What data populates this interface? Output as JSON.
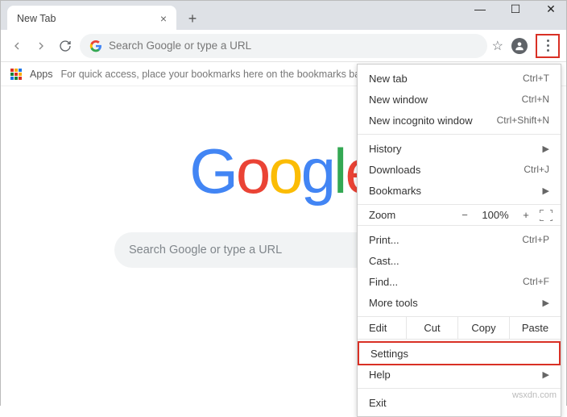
{
  "window": {
    "tab_title": "New Tab"
  },
  "omnibox": {
    "placeholder": "Search Google or type a URL"
  },
  "bookmarks_bar": {
    "apps_label": "Apps",
    "hint": "For quick access, place your bookmarks here on the bookmarks ba"
  },
  "ntp": {
    "logo": [
      "G",
      "o",
      "o",
      "g",
      "l",
      "e"
    ],
    "search_placeholder": "Search Google or type a URL"
  },
  "menu": {
    "new_tab": {
      "label": "New tab",
      "shortcut": "Ctrl+T"
    },
    "new_window": {
      "label": "New window",
      "shortcut": "Ctrl+N"
    },
    "new_incognito": {
      "label": "New incognito window",
      "shortcut": "Ctrl+Shift+N"
    },
    "history": {
      "label": "History"
    },
    "downloads": {
      "label": "Downloads",
      "shortcut": "Ctrl+J"
    },
    "bookmarks": {
      "label": "Bookmarks"
    },
    "zoom": {
      "label": "Zoom",
      "minus": "−",
      "value": "100%",
      "plus": "+"
    },
    "print": {
      "label": "Print...",
      "shortcut": "Ctrl+P"
    },
    "cast": {
      "label": "Cast..."
    },
    "find": {
      "label": "Find...",
      "shortcut": "Ctrl+F"
    },
    "more_tools": {
      "label": "More tools"
    },
    "edit": {
      "label": "Edit",
      "cut": "Cut",
      "copy": "Copy",
      "paste": "Paste"
    },
    "settings": {
      "label": "Settings"
    },
    "help": {
      "label": "Help"
    },
    "exit": {
      "label": "Exit"
    }
  },
  "watermark": "wsxdn.com"
}
